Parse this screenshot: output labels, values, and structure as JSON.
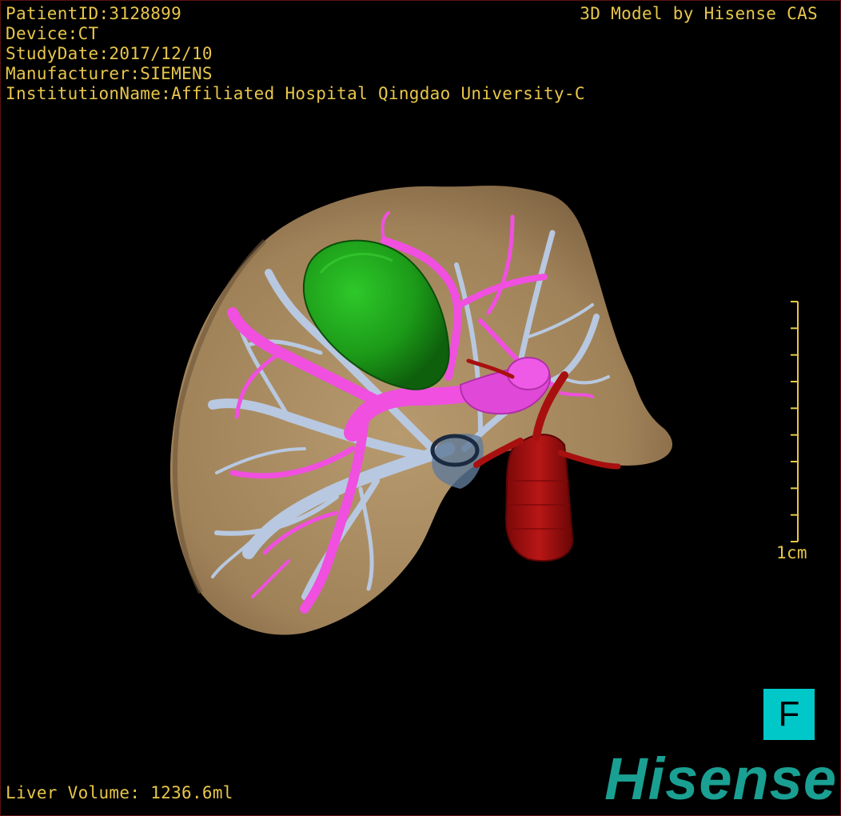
{
  "study": {
    "patient_id": "PatientID:3128899",
    "device": "Device:CT",
    "study_date": "StudyDate:2017/12/10",
    "manufacturer": "Manufacturer:SIEMENS",
    "institution": "InstitutionName:Affiliated Hospital Qingdao University-C"
  },
  "brand_text": "3D Model by Hisense CAS",
  "scale_bar": {
    "label": "1cm",
    "ticks": 10,
    "color": "#e8c64b"
  },
  "orientation_marker": "F",
  "liver_volume": "Liver Volume: 1236.6ml",
  "logo_text": "Hisense",
  "colors": {
    "overlay_text": "#e8c64b",
    "liver": "#a88b62",
    "hepatic_vein": "#b8c8e0",
    "portal_vein": "#f04fe0",
    "lesion": "#22a81e",
    "artery": "#a81010",
    "gallbladder_duct": "#3a5a80",
    "orientation_bg": "#00c8c8",
    "logo": "#1aa092"
  }
}
